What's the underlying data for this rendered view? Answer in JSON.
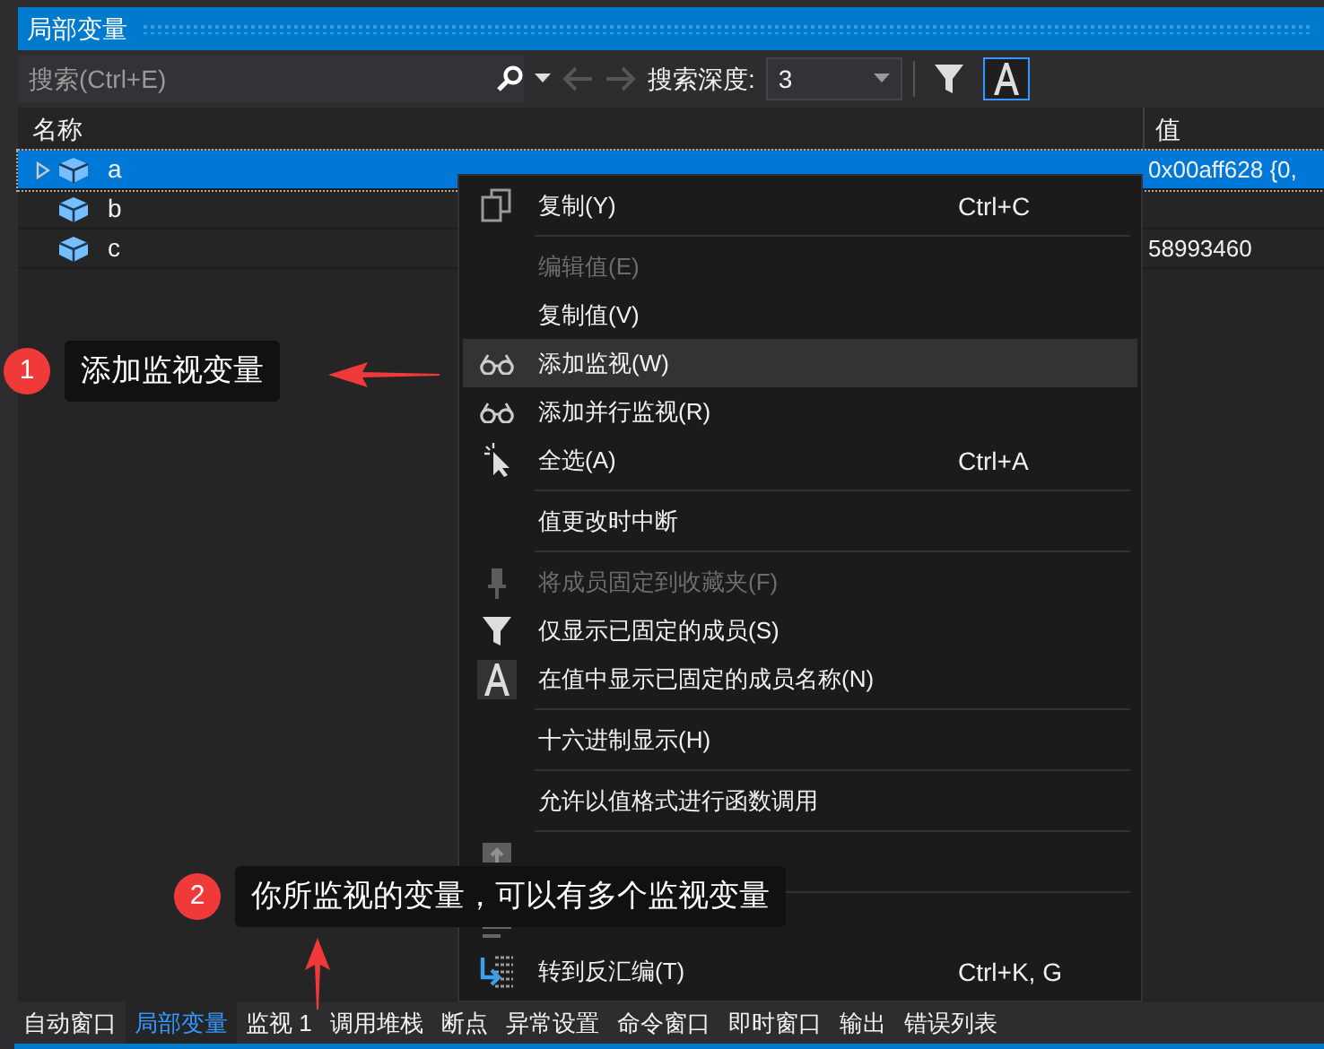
{
  "window": {
    "title": "局部变量"
  },
  "toolbar": {
    "search": {
      "placeholder": "搜索(Ctrl+E)"
    },
    "depth_label": "搜索深度:",
    "depth_value": "3",
    "filter_on": false,
    "show_names_on": true
  },
  "table": {
    "columns": [
      "名称",
      "值"
    ],
    "rows": [
      {
        "name": "a",
        "value": "0x00aff628 {0,",
        "expandable": true,
        "selected": true
      },
      {
        "name": "b",
        "value": "",
        "expandable": false,
        "selected": false
      },
      {
        "name": "c",
        "value": "58993460",
        "expandable": false,
        "selected": false
      }
    ]
  },
  "context_menu": [
    {
      "kind": "item",
      "label": "复制(Y)",
      "shortcut": "Ctrl+C",
      "disabled": false,
      "highlighted": false
    },
    {
      "kind": "separator"
    },
    {
      "kind": "item",
      "label": "编辑值(E)",
      "disabled": true,
      "highlighted": false
    },
    {
      "kind": "item",
      "label": "复制值(V)",
      "disabled": false,
      "highlighted": false
    },
    {
      "kind": "item",
      "label": "添加监视(W)",
      "disabled": false,
      "highlighted": true
    },
    {
      "kind": "item",
      "label": "添加并行监视(R)",
      "disabled": false,
      "highlighted": false
    },
    {
      "kind": "item",
      "label": "全选(A)",
      "shortcut": "Ctrl+A",
      "disabled": false,
      "highlighted": false
    },
    {
      "kind": "separator"
    },
    {
      "kind": "item",
      "label": "值更改时中断",
      "disabled": false,
      "highlighted": false
    },
    {
      "kind": "separator"
    },
    {
      "kind": "item",
      "label": "将成员固定到收藏夹(F)",
      "disabled": true,
      "highlighted": false
    },
    {
      "kind": "item",
      "label": "仅显示已固定的成员(S)",
      "disabled": false,
      "highlighted": false
    },
    {
      "kind": "item",
      "label": "在值中显示已固定的成员名称(N)",
      "disabled": false,
      "highlighted": false
    },
    {
      "kind": "separator"
    },
    {
      "kind": "item",
      "label": "十六进制显示(H)",
      "disabled": false,
      "highlighted": false
    },
    {
      "kind": "separator"
    },
    {
      "kind": "item",
      "label": "允许以值格式进行函数调用",
      "disabled": false,
      "highlighted": false
    },
    {
      "kind": "separator"
    },
    {
      "kind": "item",
      "disabled": true,
      "highlighted": false
    },
    {
      "kind": "separator"
    },
    {
      "kind": "item",
      "disabled": true,
      "highlighted": false
    },
    {
      "kind": "item",
      "label": "转到反汇编(T)",
      "shortcut": "Ctrl+K, G",
      "disabled": false,
      "highlighted": false
    }
  ],
  "callouts": [
    {
      "number": "1",
      "text": "添加监视变量"
    },
    {
      "number": "2",
      "text": "你所监视的变量，可以有多个监视变量"
    }
  ],
  "bottom_tabs": [
    {
      "label": "自动窗口",
      "selected": false
    },
    {
      "label": "局部变量",
      "selected": true
    },
    {
      "label": "监视 1",
      "selected": false
    },
    {
      "label": "调用堆栈",
      "selected": false
    },
    {
      "label": "断点",
      "selected": false
    },
    {
      "label": "异常设置",
      "selected": false
    },
    {
      "label": "命令窗口",
      "selected": false
    },
    {
      "label": "即时窗口",
      "selected": false
    },
    {
      "label": "输出",
      "selected": false
    },
    {
      "label": "错误列表",
      "selected": false
    }
  ]
}
